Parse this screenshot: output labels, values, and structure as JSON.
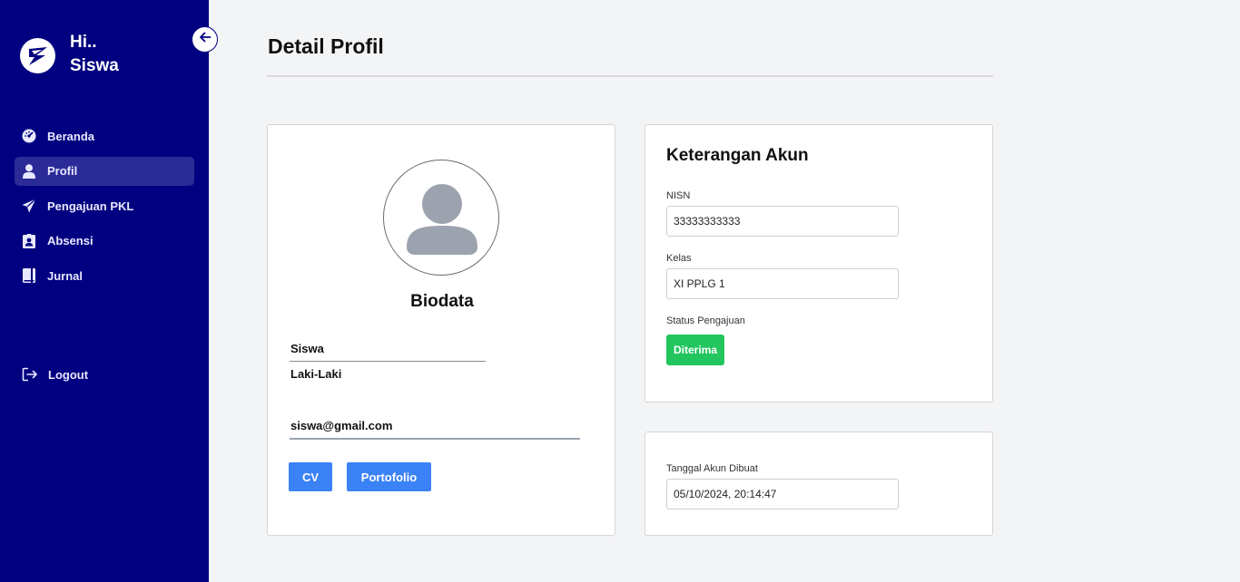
{
  "sidebar": {
    "greeting_line1": "Hi..",
    "greeting_line2": "Siswa",
    "logo_icon": "app-logo-icon",
    "collapse_icon": "arrow-left-icon",
    "items": [
      {
        "label": "Beranda",
        "icon": "dashboard-gauge-icon",
        "active": false
      },
      {
        "label": "Profil",
        "icon": "user-icon",
        "active": true
      },
      {
        "label": "Pengajuan PKL",
        "icon": "paper-plane-icon",
        "active": false
      },
      {
        "label": "Absensi",
        "icon": "id-badge-icon",
        "active": false
      },
      {
        "label": "Jurnal",
        "icon": "book-icon",
        "active": false
      }
    ],
    "logout": {
      "label": "Logout",
      "icon": "sign-out-icon"
    }
  },
  "main": {
    "title": "Detail Profil"
  },
  "biodata": {
    "title": "Biodata",
    "avatar_icon": "user-avatar-placeholder-icon",
    "name": "Siswa",
    "gender": "Laki-Laki",
    "email": "siswa@gmail.com",
    "cv_button": "CV",
    "portfolio_button": "Portofolio"
  },
  "account": {
    "title": "Keterangan Akun",
    "nisn_label": "NISN",
    "nisn_value": "33333333333",
    "class_label": "Kelas",
    "class_value": "XI PPLG 1",
    "status_label": "Status Pengajuan",
    "status_value": "Diterima",
    "created_label": "Tanggal Akun Dibuat",
    "created_value": "05/10/2024, 20:14:47"
  },
  "colors": {
    "sidebar_bg": "#000080",
    "active_item_bg": "#2b2b97",
    "button_blue": "#3b82f6",
    "status_green": "#22c55e"
  }
}
